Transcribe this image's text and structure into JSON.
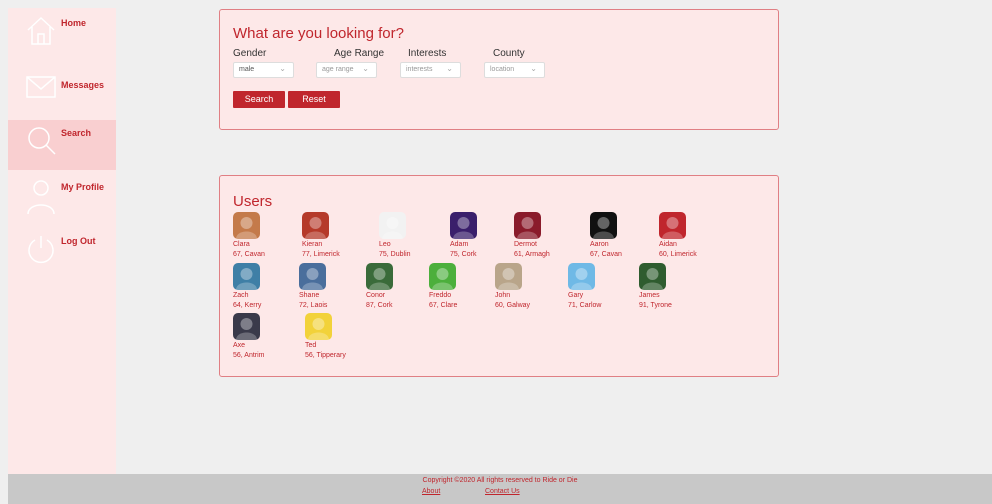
{
  "nav": {
    "items": [
      {
        "label": "Home",
        "icon": "home-icon"
      },
      {
        "label": "Messages",
        "icon": "mail-icon"
      },
      {
        "label": "Search",
        "icon": "search-icon",
        "active": true
      },
      {
        "label": "My Profile",
        "icon": "user-icon"
      },
      {
        "label": "Log Out",
        "icon": "power-icon"
      }
    ]
  },
  "search": {
    "title": "What are you looking for?",
    "gender_label": "Gender",
    "age_label": "Age Range",
    "interests_label": "Interests",
    "county_label": "County",
    "gender_value": "male",
    "age_placeholder": "age range",
    "interests_placeholder": "interests",
    "county_placeholder": "location",
    "search_button": "Search",
    "reset_button": "Reset"
  },
  "users": {
    "title": "Users",
    "list": [
      {
        "name": "Clara",
        "info": "67, Cavan",
        "color": "#c47a4a"
      },
      {
        "name": "Kieran",
        "info": "77, Limerick",
        "color": "#b53a2a"
      },
      {
        "name": "Leo",
        "info": "75, Dublin",
        "color": "#f2f2f2"
      },
      {
        "name": "Adam",
        "info": "75, Cork",
        "color": "#3a1f6b"
      },
      {
        "name": "Dermot",
        "info": "61, Armagh",
        "color": "#8a1b2b"
      },
      {
        "name": "Aaron",
        "info": "67, Cavan",
        "color": "#111111"
      },
      {
        "name": "Aidan",
        "info": "60, Limerick",
        "color": "#c0262d"
      },
      {
        "name": "Zach",
        "info": "64, Kerry",
        "color": "#3f7fa6"
      },
      {
        "name": "Shane",
        "info": "72, Laois",
        "color": "#4a6e9c"
      },
      {
        "name": "Conor",
        "info": "87, Cork",
        "color": "#3a6b3a"
      },
      {
        "name": "Freddo",
        "info": "67, Clare",
        "color": "#4caf3c"
      },
      {
        "name": "John",
        "info": "60, Galway",
        "color": "#b9a58a"
      },
      {
        "name": "Gary",
        "info": "71, Carlow",
        "color": "#6fb9e6"
      },
      {
        "name": "James",
        "info": "91, Tyrone",
        "color": "#2f5c2f"
      },
      {
        "name": "Axe",
        "info": "56, Antrim",
        "color": "#3a3a4a"
      },
      {
        "name": "Ted",
        "info": "56, Tipperary",
        "color": "#f2d23a"
      }
    ]
  },
  "footer": {
    "copyright": "Copyright ©2020 All rights reserved to Ride or Die",
    "about": "About",
    "contact": "Contact Us"
  },
  "colors": {
    "accent": "#c0262d",
    "panel_bg": "#fde8e8",
    "active_nav_bg": "#f9cfd0"
  }
}
